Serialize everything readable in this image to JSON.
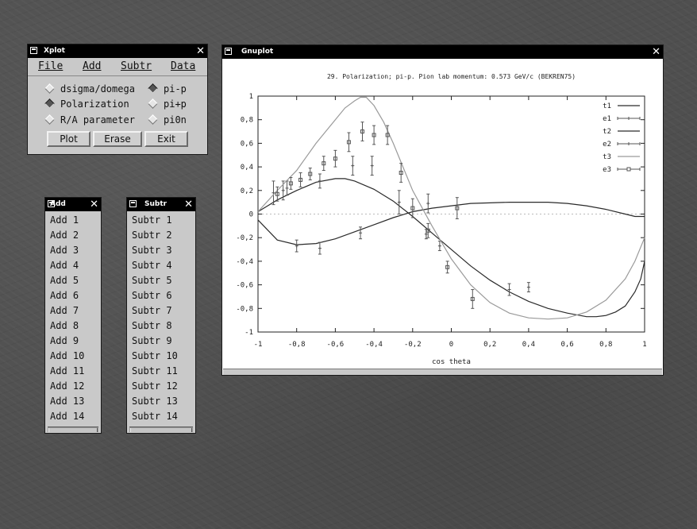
{
  "xplot": {
    "title": "Xplot",
    "menu": [
      "File",
      "Add",
      "Subtr",
      "Data"
    ],
    "options": [
      {
        "label": "dsigma/domega",
        "selected": false
      },
      {
        "label": "Polarization",
        "selected": true
      },
      {
        "label": "R/A parameter",
        "selected": false
      }
    ],
    "reactions": [
      {
        "label": "pi-p",
        "selected": true
      },
      {
        "label": "pi+p",
        "selected": false
      },
      {
        "label": "pi0n",
        "selected": false
      }
    ],
    "buttons": {
      "plot": "Plot",
      "erase": "Erase",
      "exit": "Exit"
    }
  },
  "add_menu": {
    "title": "Add",
    "items": [
      "Add 1",
      "Add 2",
      "Add 3",
      "Add 4",
      "Add 5",
      "Add 6",
      "Add 7",
      "Add 8",
      "Add 9",
      "Add 10",
      "Add 11",
      "Add 12",
      "Add 13",
      "Add 14"
    ]
  },
  "subtr_menu": {
    "title": "Subtr",
    "items": [
      "Subtr 1",
      "Subtr 2",
      "Subtr 3",
      "Subtr 4",
      "Subtr 5",
      "Subtr 6",
      "Subtr 7",
      "Subtr 8",
      "Subtr 9",
      "Subtr 10",
      "Subtr 11",
      "Subtr 12",
      "Subtr 13",
      "Subtr 14"
    ]
  },
  "gnuplot": {
    "title": "Gnuplot",
    "chart_data": {
      "type": "line",
      "title": "29. Polarization; pi-p. Pion lab momentum: 0.573 GeV/c (BEKREN75)",
      "xlabel": "cos theta",
      "ylabel": "",
      "xlim": [
        -1,
        1
      ],
      "ylim": [
        -1,
        1
      ],
      "xticks": [
        "-1",
        "-0,8",
        "-0,6",
        "-0,4",
        "-0,2",
        "0",
        "0,2",
        "0,4",
        "0,6",
        "0,8",
        "1"
      ],
      "xtick_values": [
        -1,
        -0.8,
        -0.6,
        -0.4,
        -0.2,
        0,
        0.2,
        0.4,
        0.6,
        0.8,
        1
      ],
      "yticks": [
        "-1",
        "-0,8",
        "-0,6",
        "-0,4",
        "-0,2",
        "0",
        "0,2",
        "0,4",
        "0,6",
        "0,8",
        "1"
      ],
      "ytick_values": [
        -1,
        -0.8,
        -0.6,
        -0.4,
        -0.2,
        0,
        0.2,
        0.4,
        0.6,
        0.8,
        1
      ],
      "legend_position": "top-right",
      "series": [
        {
          "name": "t1",
          "kind": "line",
          "color": "#2a2a2a",
          "x": [
            -1,
            -0.9,
            -0.8,
            -0.7,
            -0.6,
            -0.5,
            -0.4,
            -0.3,
            -0.2,
            -0.1,
            0,
            0.1,
            0.2,
            0.3,
            0.4,
            0.5,
            0.6,
            0.7,
            0.8,
            0.9,
            0.95,
            1
          ],
          "y": [
            -0.05,
            -0.22,
            -0.26,
            -0.25,
            -0.21,
            -0.15,
            -0.09,
            -0.03,
            0.02,
            0.05,
            0.07,
            0.09,
            0.095,
            0.1,
            0.1,
            0.1,
            0.09,
            0.07,
            0.04,
            0.0,
            -0.02,
            -0.02
          ]
        },
        {
          "name": "e1",
          "kind": "errorbar",
          "color": "#555555",
          "marker": "plus",
          "x": [
            -0.8,
            -0.68,
            -0.47,
            -0.13,
            -0.06
          ],
          "y": [
            -0.27,
            -0.29,
            -0.16,
            -0.17,
            -0.27
          ],
          "err": [
            0.05,
            0.05,
            0.05,
            0.04,
            0.04
          ]
        },
        {
          "name": "t2",
          "kind": "line",
          "color": "#2a2a2a",
          "x": [
            -1,
            -0.95,
            -0.9,
            -0.85,
            -0.8,
            -0.7,
            -0.6,
            -0.55,
            -0.5,
            -0.4,
            -0.3,
            -0.2,
            -0.1,
            0,
            0.1,
            0.2,
            0.3,
            0.4,
            0.5,
            0.6,
            0.7,
            0.75,
            0.8,
            0.85,
            0.9,
            0.95,
            0.98,
            1
          ],
          "y": [
            0.02,
            0.07,
            0.12,
            0.16,
            0.2,
            0.27,
            0.3,
            0.3,
            0.28,
            0.21,
            0.11,
            -0.02,
            -0.16,
            -0.3,
            -0.44,
            -0.56,
            -0.66,
            -0.74,
            -0.8,
            -0.84,
            -0.87,
            -0.87,
            -0.86,
            -0.83,
            -0.78,
            -0.66,
            -0.55,
            -0.4
          ]
        },
        {
          "name": "e2",
          "kind": "errorbar",
          "color": "#555555",
          "marker": "plus",
          "x": [
            -0.92,
            -0.87,
            -0.85,
            -0.68,
            -0.51,
            -0.41,
            -0.27,
            -0.12,
            0.3,
            0.4
          ],
          "y": [
            0.18,
            0.2,
            0.22,
            0.28,
            0.41,
            0.41,
            0.1,
            0.09,
            -0.64,
            -0.62
          ],
          "err": [
            0.1,
            0.08,
            0.06,
            0.06,
            0.08,
            0.08,
            0.1,
            0.08,
            0.05,
            0.04
          ]
        },
        {
          "name": "t3",
          "kind": "line",
          "color": "#9a9a9a",
          "x": [
            -1,
            -0.9,
            -0.8,
            -0.7,
            -0.6,
            -0.55,
            -0.5,
            -0.47,
            -0.44,
            -0.4,
            -0.35,
            -0.3,
            -0.25,
            -0.2,
            -0.1,
            0,
            0.1,
            0.2,
            0.3,
            0.4,
            0.5,
            0.6,
            0.7,
            0.8,
            0.9,
            0.95,
            1
          ],
          "y": [
            0.02,
            0.2,
            0.37,
            0.6,
            0.8,
            0.9,
            0.96,
            0.99,
            0.99,
            0.92,
            0.78,
            0.6,
            0.4,
            0.2,
            -0.1,
            -0.38,
            -0.6,
            -0.75,
            -0.84,
            -0.88,
            -0.89,
            -0.88,
            -0.83,
            -0.73,
            -0.55,
            -0.4,
            -0.2
          ]
        },
        {
          "name": "e3",
          "kind": "errorbar",
          "color": "#555555",
          "marker": "square",
          "x": [
            -0.9,
            -0.83,
            -0.78,
            -0.73,
            -0.66,
            -0.6,
            -0.53,
            -0.46,
            -0.4,
            -0.33,
            -0.26,
            -0.2,
            -0.12,
            -0.02,
            0.03,
            0.11
          ],
          "y": [
            0.17,
            0.26,
            0.29,
            0.34,
            0.43,
            0.47,
            0.61,
            0.7,
            0.67,
            0.67,
            0.35,
            0.05,
            -0.14,
            -0.45,
            0.05,
            -0.72
          ],
          "err": [
            0.06,
            0.05,
            0.06,
            0.05,
            0.06,
            0.07,
            0.08,
            0.08,
            0.08,
            0.08,
            0.08,
            0.08,
            0.06,
            0.05,
            0.09,
            0.08
          ]
        }
      ]
    }
  }
}
